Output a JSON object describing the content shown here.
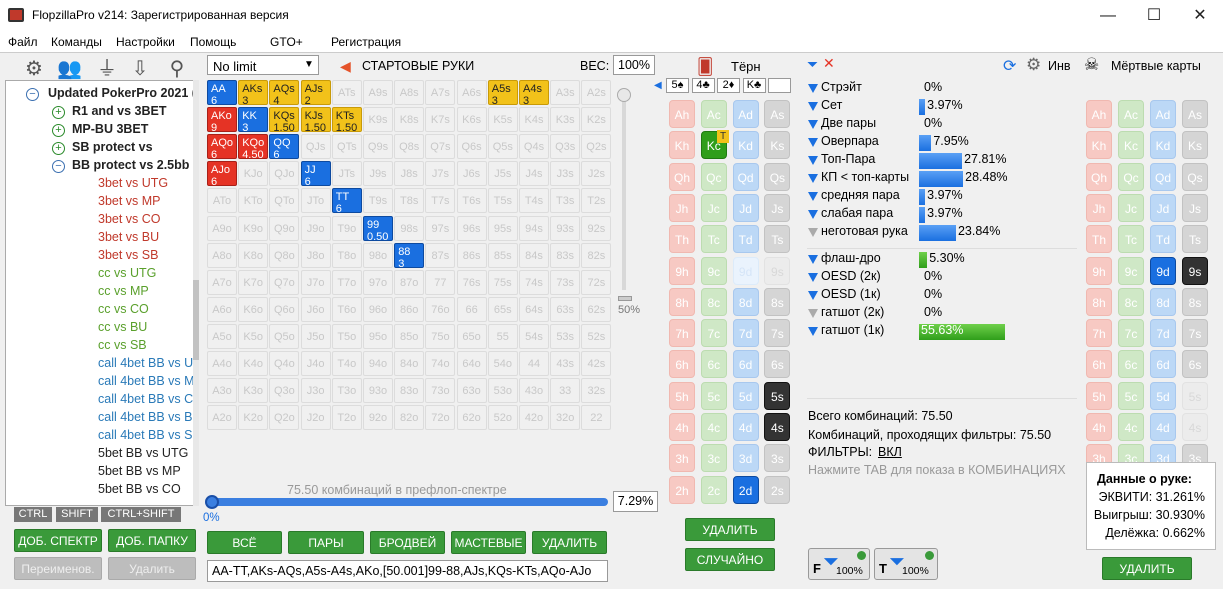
{
  "window": {
    "title": "FlopzillaPro v214: Зарегистрированная версия",
    "min": "—",
    "max": "☐",
    "close": "✕"
  },
  "menu": [
    "Файл",
    "Команды",
    "Настройки",
    "Помощь",
    "|",
    "GTO+",
    "|",
    "Регистрация"
  ],
  "tree": {
    "items": [
      {
        "label": "Updated PokerPro 2021 (",
        "cls": "tree-root",
        "exp": "minus"
      },
      {
        "label": "R1 and vs 3BET",
        "cls": "tree-folder",
        "exp": "plus"
      },
      {
        "label": "MP-BU 3BET",
        "cls": "tree-folder",
        "exp": "plus"
      },
      {
        "label": "SB protect vs",
        "cls": "tree-folder",
        "exp": "plus"
      },
      {
        "label": "BB protect vs 2.5bb",
        "cls": "tree-folder",
        "exp": "minus"
      },
      {
        "label": "3bet vs UTG",
        "cls": "tree-red"
      },
      {
        "label": "3bet vs MP",
        "cls": "tree-red"
      },
      {
        "label": "3bet vs CO",
        "cls": "tree-red"
      },
      {
        "label": "3bet vs BU",
        "cls": "tree-red"
      },
      {
        "label": "3bet vs SB",
        "cls": "tree-red"
      },
      {
        "label": "cc vs UTG",
        "cls": "tree-green"
      },
      {
        "label": "cc vs MP",
        "cls": "tree-green"
      },
      {
        "label": "cc vs CO",
        "cls": "tree-green"
      },
      {
        "label": "cc vs BU",
        "cls": "tree-green"
      },
      {
        "label": "cc vs SB",
        "cls": "tree-green"
      },
      {
        "label": "call 4bet BB vs UT",
        "cls": "tree-blue"
      },
      {
        "label": "call 4bet BB vs M",
        "cls": "tree-blue"
      },
      {
        "label": "call 4bet BB vs CO",
        "cls": "tree-blue"
      },
      {
        "label": "call 4bet BB vs BU",
        "cls": "tree-blue"
      },
      {
        "label": "call 4bet BB vs SB",
        "cls": "tree-blue"
      },
      {
        "label": "5bet BB vs UTG",
        "cls": "tree-dark"
      },
      {
        "label": "5bet BB vs MP",
        "cls": "tree-dark"
      },
      {
        "label": "5bet BB vs CO",
        "cls": "tree-dark"
      }
    ],
    "keys": [
      "CTRL",
      "SHIFT",
      "CTRL+SHIFT"
    ],
    "btn_add_range": "ДОБ. СПЕКТР",
    "btn_add_folder": "ДОБ. ПАПКУ",
    "btn_rename": "Переименов.",
    "btn_delete": "Удалить"
  },
  "range": {
    "game": "No limit",
    "section_title": "СТАРТОВЫЕ РУКИ",
    "weight_label": "ВЕС:",
    "weight_value": "100%",
    "slider_low": "50%",
    "combos_text": "75.50 комбинаций в префлоп-спектре",
    "pct_value": "7.29%",
    "pb_left": "0%",
    "btn_all": "ВСЁ",
    "btn_pairs": "ПАРЫ",
    "btn_broadway": "БРОДВЕЙ",
    "btn_suited": "МАСТЕВЫЕ",
    "btn_delete": "УДАЛИТЬ",
    "range_text": "AA-TT,AKs-AQs,A5s-A4s,AKo,[50.001]99-88,AJs,KQs-KTs,AQo-AJo",
    "grid": [
      [
        "AA|6|blue",
        "AKs|3|yel",
        "AQs|4|yel",
        "AJs|2|yel",
        "ATs||e",
        "A9s||e",
        "A8s||e",
        "A7s||e",
        "A6s||e",
        "A5s|3|yel",
        "A4s|3|yel",
        "A3s||e",
        "A2s||e"
      ],
      [
        "AKo|9|red",
        "KK|3|blue",
        "KQs|1.50|yel",
        "KJs|1.50|yel",
        "KTs|1.50|yel",
        "K9s||e",
        "K8s||e",
        "K7s||e",
        "K6s||e",
        "K5s||e",
        "K4s||e",
        "K3s||e",
        "K2s||e"
      ],
      [
        "AQo|6|red",
        "KQo|4.50|red",
        "QQ|6|blue",
        "QJs||e",
        "QTs||e",
        "Q9s||e",
        "Q8s||e",
        "Q7s||e",
        "Q6s||e",
        "Q5s||e",
        "Q4s||e",
        "Q3s||e",
        "Q2s||e"
      ],
      [
        "AJo|6|red",
        "KJo||e",
        "QJo||e",
        "JJ|6|blue",
        "JTs||e",
        "J9s||e",
        "J8s||e",
        "J7s||e",
        "J6s||e",
        "J5s||e",
        "J4s||e",
        "J3s||e",
        "J2s||e"
      ],
      [
        "ATo||e",
        "KTo||e",
        "QTo||e",
        "JTo||e",
        "TT|6|blue",
        "T9s||e",
        "T8s||e",
        "T7s||e",
        "T6s||e",
        "T5s||e",
        "T4s||e",
        "T3s||e",
        "T2s||e"
      ],
      [
        "A9o||e",
        "K9o||e",
        "Q9o||e",
        "J9o||e",
        "T9o||e",
        "99|0.50|blue",
        "98s||e",
        "97s||e",
        "96s||e",
        "95s||e",
        "94s||e",
        "93s||e",
        "92s||e"
      ],
      [
        "A8o||e",
        "K8o||e",
        "Q8o||e",
        "J8o||e",
        "T8o||e",
        "98o||e",
        "88|3|blue",
        "87s||e",
        "86s||e",
        "85s||e",
        "84s||e",
        "83s||e",
        "82s||e"
      ],
      [
        "A7o||e",
        "K7o||e",
        "Q7o||e",
        "J7o||e",
        "T7o||e",
        "97o||e",
        "87o||e",
        "77||e",
        "76s||e",
        "75s||e",
        "74s||e",
        "73s||e",
        "72s||e"
      ],
      [
        "A6o||e",
        "K6o||e",
        "Q6o||e",
        "J6o||e",
        "T6o||e",
        "96o||e",
        "86o||e",
        "76o||e",
        "66||e",
        "65s||e",
        "64s||e",
        "63s||e",
        "62s||e"
      ],
      [
        "A5o||e",
        "K5o||e",
        "Q5o||e",
        "J5o||e",
        "T5o||e",
        "95o||e",
        "85o||e",
        "75o||e",
        "65o||e",
        "55||e",
        "54s||e",
        "53s||e",
        "52s||e"
      ],
      [
        "A4o||e",
        "K4o||e",
        "Q4o||e",
        "J4o||e",
        "T4o||e",
        "94o||e",
        "84o||e",
        "74o||e",
        "64o||e",
        "54o||e",
        "44||e",
        "43s||e",
        "42s||e"
      ],
      [
        "A3o||e",
        "K3o||e",
        "Q3o||e",
        "J3o||e",
        "T3o||e",
        "93o||e",
        "83o||e",
        "73o||e",
        "63o||e",
        "53o||e",
        "43o||e",
        "33||e",
        "32s||e"
      ],
      [
        "A2o||e",
        "K2o||e",
        "Q2o||e",
        "J2o||e",
        "T2o||e",
        "92o||e",
        "82o||e",
        "72o||e",
        "62o||e",
        "52o||e",
        "42o||e",
        "32o||e",
        "22||e"
      ]
    ]
  },
  "board": {
    "title": "Тёрн",
    "slots": [
      "5♠",
      "4♣",
      "2♦",
      "K♣",
      ""
    ],
    "btn_delete": "УДАЛИТЬ",
    "btn_random": "СЛУЧАЙНО",
    "turn_marker": "T",
    "cards": [
      [
        "Ah|c-h",
        "Ac|c-c",
        "Ad|c-d",
        "As|c-s"
      ],
      [
        "Kh|c-h",
        "Kc|c-sel-c",
        "Kd|c-d",
        "Ks|c-s"
      ],
      [
        "Qh|c-h",
        "Qc|c-c",
        "Qd|c-d",
        "Qs|c-s"
      ],
      [
        "Jh|c-h",
        "Jc|c-c",
        "Jd|c-d",
        "Js|c-s"
      ],
      [
        "Th|c-h",
        "Tc|c-c",
        "Td|c-d",
        "Ts|c-s"
      ],
      [
        "9h|c-h",
        "9c|c-c",
        "9d|c-dL",
        "9s|c-sL"
      ],
      [
        "8h|c-h",
        "8c|c-c",
        "8d|c-d",
        "8s|c-s"
      ],
      [
        "7h|c-h",
        "7c|c-c",
        "7d|c-d",
        "7s|c-s"
      ],
      [
        "6h|c-h",
        "6c|c-c",
        "6d|c-d",
        "6s|c-s"
      ],
      [
        "5h|c-h",
        "5c|c-c",
        "5d|c-d",
        "5s|c-sel-s"
      ],
      [
        "4h|c-h",
        "4c|c-c",
        "4d|c-d",
        "4s|c-sel-s"
      ],
      [
        "3h|c-h",
        "3c|c-c",
        "3d|c-d",
        "3s|c-s"
      ],
      [
        "2h|c-h",
        "2c|c-c",
        "2d|c-sel-d",
        "2s|c-s"
      ]
    ]
  },
  "stats": {
    "inv_label": "Инв",
    "rows": [
      {
        "label": "Стрэйт",
        "pct": "0%",
        "value": 0,
        "f": "b"
      },
      {
        "label": "Сет",
        "pct": "3.97%",
        "value": 3.97,
        "f": "b"
      },
      {
        "label": "Две пары",
        "pct": "0%",
        "value": 0,
        "f": "b"
      },
      {
        "label": "Оверпара",
        "pct": "7.95%",
        "value": 7.95,
        "f": "b"
      },
      {
        "label": "Топ-Пара",
        "pct": "27.81%",
        "value": 27.81,
        "f": "b"
      },
      {
        "label": "КП < топ-карты",
        "pct": "28.48%",
        "value": 28.48,
        "f": "b"
      },
      {
        "label": "средняя пара",
        "pct": "3.97%",
        "value": 3.97,
        "f": "b"
      },
      {
        "label": "слабая пара",
        "pct": "3.97%",
        "value": 3.97,
        "f": "b"
      },
      {
        "label": "неготовая рука",
        "pct": "23.84%",
        "value": 23.84,
        "f": "g"
      }
    ],
    "draws": [
      {
        "label": "флаш-дро",
        "pct": "5.30%",
        "value": 5.3,
        "f": "b"
      },
      {
        "label": "OESD (2к)",
        "pct": "0%",
        "value": 0,
        "f": "b"
      },
      {
        "label": "OESD (1к)",
        "pct": "0%",
        "value": 0,
        "f": "b"
      },
      {
        "label": "гатшот (2к)",
        "pct": "0%",
        "value": 0,
        "f": "g"
      },
      {
        "label": "гатшот (1к)",
        "pct": "55.63%",
        "value": 55.63,
        "f": "b"
      }
    ],
    "total_combos": "Всего комбинаций: 75.50",
    "passing": "Комбинаций, проходящих фильтры: 75.50",
    "filters_label": "ФИЛЬТРЫ:",
    "filters_value": "ВКЛ",
    "tab_hint": "Нажмите TAB для показа в КОМБИНАЦИЯХ",
    "f_btn": "F",
    "f_pct": "100%",
    "t_btn": "T",
    "t_pct": "100%"
  },
  "dead": {
    "title": "Мёртвые карты",
    "btn_delete": "УДАЛИТЬ",
    "cards": [
      [
        "Ah|c-h",
        "Ac|c-c",
        "Ad|c-d",
        "As|c-s"
      ],
      [
        "Kh|c-h",
        "Kc|c-c",
        "Kd|c-d",
        "Ks|c-s"
      ],
      [
        "Qh|c-h",
        "Qc|c-c",
        "Qd|c-d",
        "Qs|c-s"
      ],
      [
        "Jh|c-h",
        "Jc|c-c",
        "Jd|c-d",
        "Js|c-s"
      ],
      [
        "Th|c-h",
        "Tc|c-c",
        "Td|c-d",
        "Ts|c-s"
      ],
      [
        "9h|c-h",
        "9c|c-c",
        "9d|c-sel-d",
        "9s|c-sel-s"
      ],
      [
        "8h|c-h",
        "8c|c-c",
        "8d|c-d",
        "8s|c-s"
      ],
      [
        "7h|c-h",
        "7c|c-c",
        "7d|c-d",
        "7s|c-s"
      ],
      [
        "6h|c-h",
        "6c|c-c",
        "6d|c-d",
        "6s|c-s"
      ],
      [
        "5h|c-h",
        "5c|c-c",
        "5d|c-d",
        "5s|c-sL"
      ],
      [
        "4h|c-h",
        "4c|c-c",
        "4d|c-d",
        "4s|c-sL"
      ],
      [
        "3h|c-h",
        "3c|c-c",
        "3d|c-d",
        "3s|c-s"
      ],
      [
        "2h|c-h",
        "2c|c-c",
        "2d|c-dL",
        "2s|c-s"
      ]
    ],
    "hand_data_title": "Данные о руке:",
    "equity": "ЭКВИТИ: 31.261%",
    "win": "Выигрыш: 30.930%",
    "tie": "Делёжка: 0.662%"
  },
  "colors": {
    "accent_blue": "#1a6fe0",
    "btn_green": "#3a9a3a",
    "red": "#e53325",
    "yellow": "#f2c21a"
  }
}
